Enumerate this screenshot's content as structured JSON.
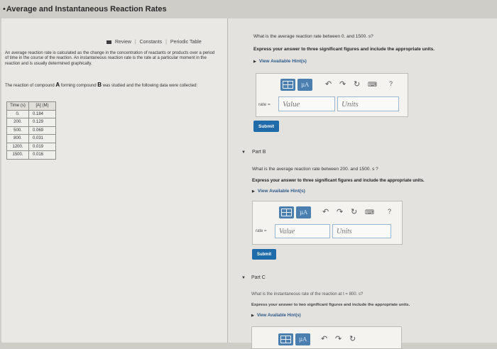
{
  "page": {
    "title": "Average and Instantaneous Reaction Rates"
  },
  "review_bar": {
    "review": "Review",
    "constants": "Constants",
    "periodic_table": "Periodic Table"
  },
  "intro": {
    "paragraph1": "An average reaction rate is calculated as the change in the concentration of reactants or products over a period of time in the course of the reaction. An instantaneous reaction rate is the rate at a particular moment in the reaction and is usually determined graphically.",
    "paragraph2_start": "The reaction of compound",
    "compound_a": "A",
    "paragraph2_mid": "forming compound",
    "compound_b": "B",
    "paragraph2_end": "was studied and the following data were collected:"
  },
  "table": {
    "headers": [
      "Time (s)",
      "[A] (M)"
    ],
    "rows": [
      [
        "0.",
        "0.184"
      ],
      [
        "200.",
        "0.129"
      ],
      [
        "500.",
        "0.069"
      ],
      [
        "800.",
        "0.031"
      ],
      [
        "1200.",
        "0.019"
      ],
      [
        "1500.",
        "0.016"
      ]
    ]
  },
  "part_a": {
    "question": "What is the average reaction rate between 0. and 1500. s?",
    "instruction": "Express your answer to three significant figures and include the appropriate units.",
    "hint": "View Available Hint(s)",
    "rate_label": "rate =",
    "value_placeholder": "Value",
    "units_placeholder": "Units",
    "submit": "Submit",
    "mu": "μA",
    "help": "?"
  },
  "part_b": {
    "label": "Part B",
    "question": "What is the average reaction rate between 200. and 1500. s ?",
    "instruction": "Express your answer to three significant figures and include the appropriate units.",
    "hint": "View Available Hint(s)",
    "rate_label": "rate =",
    "value_placeholder": "Value",
    "units_placeholder": "Units",
    "submit": "Submit",
    "mu": "μA",
    "help": "?"
  },
  "part_c": {
    "label": "Part C",
    "question": "What is the instantaneous rate of the reaction at t = 800. s?",
    "instruction": "Express your answer to two significant figures and include the appropriate units.",
    "hint": "View Available Hint(s)",
    "mu": "μA"
  }
}
